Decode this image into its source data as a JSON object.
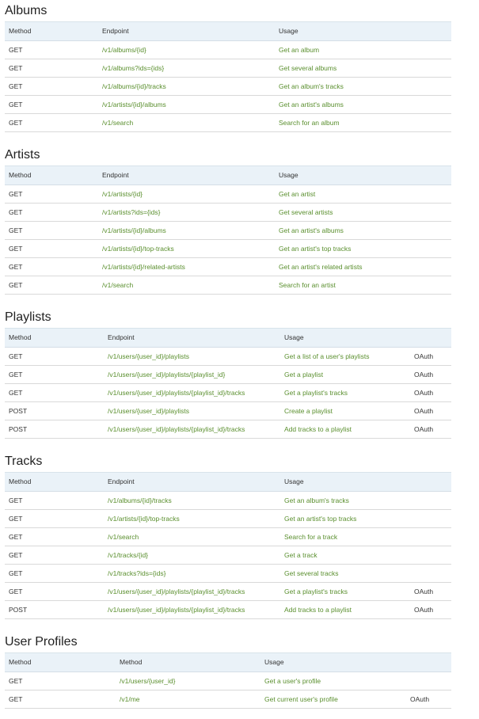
{
  "colors": {
    "header_bg": "#eaf2f8",
    "link": "#5a8f2e",
    "text": "#333333",
    "divider": "#d9d9d9"
  },
  "sections": [
    {
      "title": "Albums",
      "headers": [
        "Method",
        "Endpoint",
        "Usage",
        ""
      ],
      "rows": [
        [
          "GET",
          "/v1/albums/{id}",
          "Get an album",
          ""
        ],
        [
          "GET",
          "/v1/albums?ids={ids}",
          "Get several albums",
          ""
        ],
        [
          "GET",
          "/v1/albums/{id}/tracks",
          "Get an album's tracks",
          ""
        ],
        [
          "GET",
          "/v1/artists/{id}/albums",
          "Get an artist's albums",
          ""
        ],
        [
          "GET",
          "/v1/search",
          "Search for an album",
          ""
        ]
      ]
    },
    {
      "title": "Artists",
      "headers": [
        "Method",
        "Endpoint",
        "Usage",
        ""
      ],
      "rows": [
        [
          "GET",
          "/v1/artists/{id}",
          "Get an artist",
          ""
        ],
        [
          "GET",
          "/v1/artists?ids={ids}",
          "Get several artists",
          ""
        ],
        [
          "GET",
          "/v1/artists/{id}/albums",
          "Get an artist's albums",
          ""
        ],
        [
          "GET",
          "/v1/artists/{id}/top-tracks",
          "Get an artist's top tracks",
          ""
        ],
        [
          "GET",
          "/v1/artists/{id}/related-artists",
          "Get an artist's related artists",
          ""
        ],
        [
          "GET",
          "/v1/search",
          "Search for an artist",
          ""
        ]
      ]
    },
    {
      "title": "Playlists",
      "headers": [
        "Method",
        "Endpoint",
        "Usage",
        ""
      ],
      "rows": [
        [
          "GET",
          "/v1/users/{user_id}/playlists",
          "Get a list of a user's playlists",
          "OAuth"
        ],
        [
          "GET",
          "/v1/users/{user_id}/playlists/{playlist_id}",
          "Get a playlist",
          "OAuth"
        ],
        [
          "GET",
          "/v1/users/{user_id}/playlists/{playlist_id}/tracks",
          "Get a playlist's tracks",
          "OAuth"
        ],
        [
          "POST",
          "/v1/users/{user_id}/playlists",
          "Create a playlist",
          "OAuth"
        ],
        [
          "POST",
          "/v1/users/{user_id}/playlists/{playlist_id}/tracks",
          "Add tracks to a playlist",
          "OAuth"
        ]
      ]
    },
    {
      "title": "Tracks",
      "headers": [
        "Method",
        "Endpoint",
        "Usage",
        ""
      ],
      "rows": [
        [
          "GET",
          "/v1/albums/{id}/tracks",
          "Get an album's tracks",
          ""
        ],
        [
          "GET",
          "/v1/artists/{id}/top-tracks",
          "Get an artist's top tracks",
          ""
        ],
        [
          "GET",
          "/v1/search",
          "Search for a track",
          ""
        ],
        [
          "GET",
          "/v1/tracks/{id}",
          "Get a track",
          ""
        ],
        [
          "GET",
          "/v1/tracks?ids={ids}",
          "Get several tracks",
          ""
        ],
        [
          "GET",
          "/v1/users/{user_id}/playlists/{playlist_id}/tracks",
          "Get a playlist's tracks",
          "OAuth"
        ],
        [
          "POST",
          "/v1/users/{user_id}/playlists/{playlist_id}/tracks",
          "Add tracks to a playlist",
          "OAuth"
        ]
      ]
    },
    {
      "title": "User Profiles",
      "headers": [
        "Method",
        "Method",
        "Usage",
        ""
      ],
      "rows": [
        [
          "GET",
          "/v1/users/{user_id}",
          "Get a user's profile",
          ""
        ],
        [
          "GET",
          "/v1/me",
          "Get current user's profile",
          "OAuth"
        ]
      ]
    }
  ]
}
